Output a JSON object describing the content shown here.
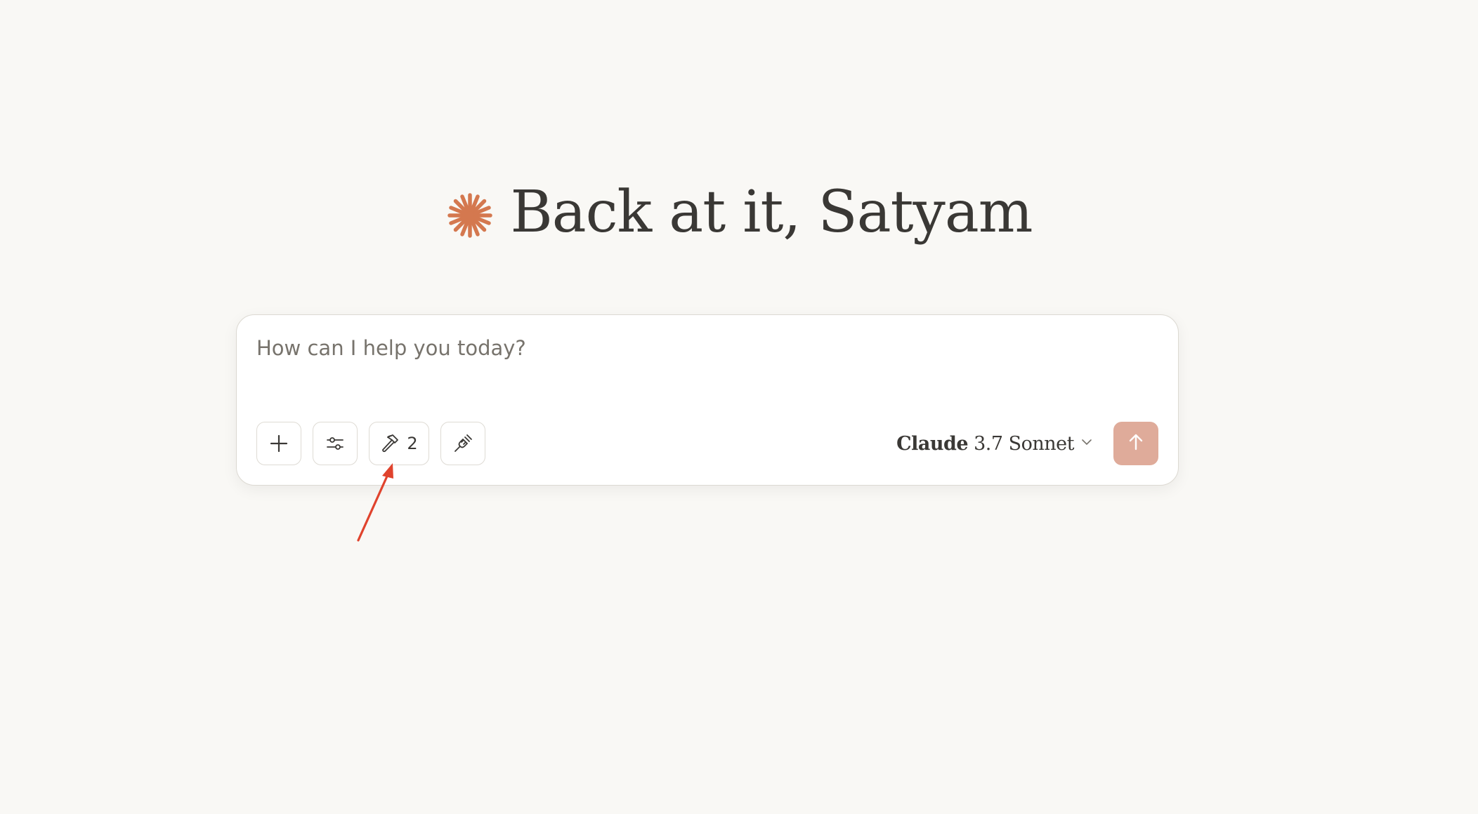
{
  "greeting": {
    "text": "Back at it, Satyam",
    "icon": "claude-spark-icon",
    "icon_color": "#d4784f"
  },
  "composer": {
    "placeholder": "How can I help you today?",
    "value": "",
    "buttons": {
      "add": "plus-icon",
      "settings": "sliders-icon",
      "tools": "hammer-icon",
      "tools_count": "2",
      "connect": "plug-icon"
    },
    "model": {
      "name": "Claude",
      "version": "3.7 Sonnet",
      "icon": "chevron-down-icon"
    },
    "send": {
      "icon": "arrow-up-icon",
      "color": "#dfab9a"
    }
  },
  "annotation": {
    "icon": "red-arrow",
    "color": "#e0432d"
  }
}
